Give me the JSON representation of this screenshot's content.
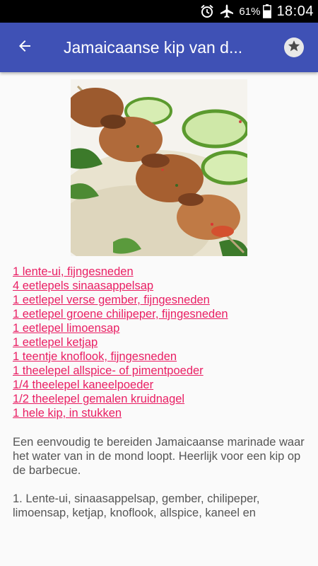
{
  "status_bar": {
    "battery_percent": "61%",
    "time": "18:04",
    "icons": [
      "alarm-icon",
      "airplane-mode-icon",
      "battery-icon"
    ]
  },
  "app_bar": {
    "title": "Jamaicaanse kip van d...",
    "back_icon": "arrow-back-icon",
    "favorite_icon": "star-icon",
    "color": "#3f51b5"
  },
  "recipe": {
    "image_alt": "recipe-photo",
    "ingredients": [
      "1 lente-ui, fijngesneden",
      "4 eetlepels sinaasappelsap",
      "1 eetlepel verse gember, fijngesneden",
      "1 eetlepel groene chilipeper, fijngesneden",
      "1 eetlepel limoensap",
      "1 eetlepel ketjap",
      "1 teentje knoflook, fijngesneden",
      "1 theelepel allspice- of pimentpoeder",
      "1/4 theelepel kaneelpoeder",
      "1/2 theelepel gemalen kruidnagel",
      "1 hele kip, in stukken"
    ],
    "description": "Een eenvoudig te bereiden Jamaicaanse marinade waar het water van in de mond loopt. Heerlijk voor een kip op de barbecue.",
    "step_1": "1. Lente-ui, sinaasappelsap, gember, chilipeper, limoensap, ketjap, knoflook, allspice, kaneel en",
    "link_color": "#e91e63"
  }
}
